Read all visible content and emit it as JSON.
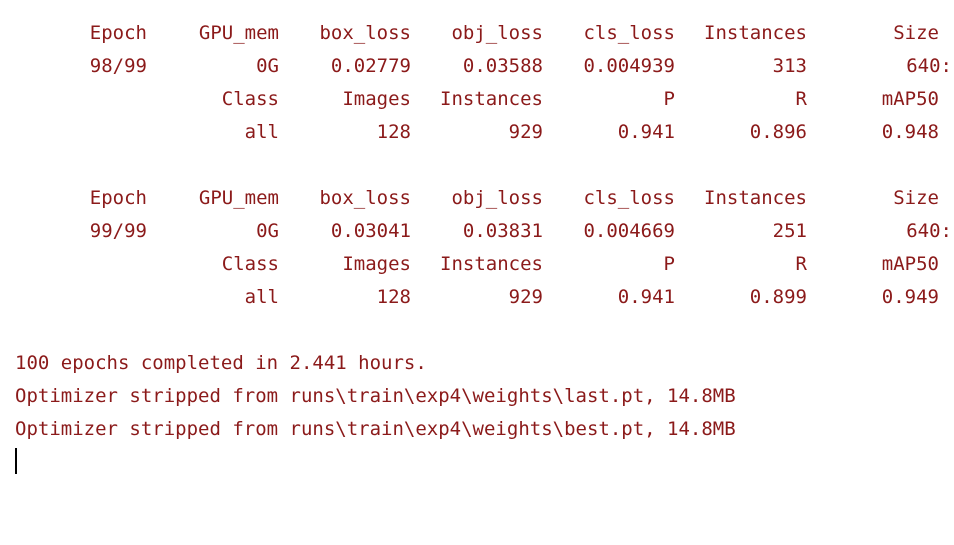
{
  "epochs": [
    {
      "header": [
        "Epoch",
        "GPU_mem",
        "box_loss",
        "obj_loss",
        "cls_loss",
        "Instances",
        "Size"
      ],
      "values": [
        "98/99",
        "0G",
        "0.02779",
        "0.03588",
        "0.004939",
        "313",
        "640:"
      ],
      "val_header": [
        "Class",
        "Images",
        "Instances",
        "P",
        "R",
        "mAP50"
      ],
      "val_values": [
        "all",
        "128",
        "929",
        "0.941",
        "0.896",
        "0.948"
      ]
    },
    {
      "header": [
        "Epoch",
        "GPU_mem",
        "box_loss",
        "obj_loss",
        "cls_loss",
        "Instances",
        "Size"
      ],
      "values": [
        "99/99",
        "0G",
        "0.03041",
        "0.03831",
        "0.004669",
        "251",
        "640:"
      ],
      "val_header": [
        "Class",
        "Images",
        "Instances",
        "P",
        "R",
        "mAP50"
      ],
      "val_values": [
        "all",
        "128",
        "929",
        "0.941",
        "0.899",
        "0.949"
      ]
    }
  ],
  "summary_lines": [
    "100 epochs completed in 2.441 hours.",
    "Optimizer stripped from runs\\train\\exp4\\weights\\last.pt, 14.8MB",
    "Optimizer stripped from runs\\train\\exp4\\weights\\best.pt, 14.8MB"
  ],
  "colors": {
    "text": "#8b1a1a",
    "background": "#ffffff",
    "cursor": "#000000"
  }
}
